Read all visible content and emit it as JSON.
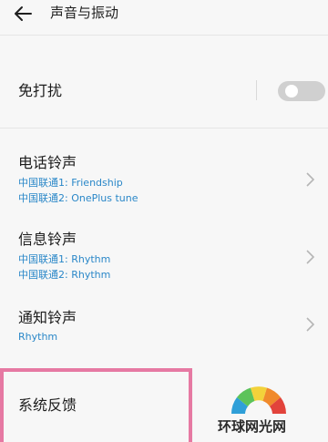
{
  "header": {
    "title": "声音与振动"
  },
  "rows": {
    "dnd": {
      "label": "免打扰",
      "toggle_on": false
    },
    "phone_ringtone": {
      "label": "电话铃声",
      "sub1": "中国联通1: Friendship",
      "sub2": "中国联通2: OnePlus tune"
    },
    "message_ringtone": {
      "label": "信息铃声",
      "sub1": "中国联通1: Rhythm",
      "sub2": "中国联通2: Rhythm"
    },
    "notification_ringtone": {
      "label": "通知铃声",
      "sub1": "Rhythm"
    },
    "system_feedback": {
      "label": "系统反馈"
    }
  },
  "watermark": {
    "text": "环球网光网"
  },
  "colors": {
    "accent_blue": "#2a87c8",
    "highlight_pink": "#e679a3",
    "background": "#f7f7f7"
  }
}
